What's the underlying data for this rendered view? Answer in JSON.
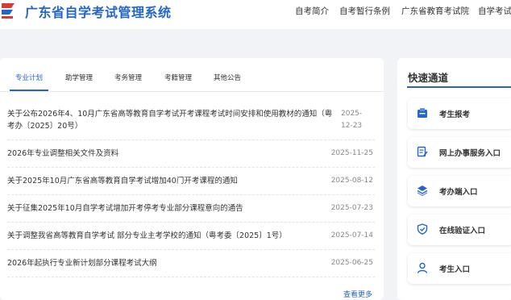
{
  "site": {
    "title": "广东省自学考试管理系统"
  },
  "nav": [
    {
      "label": "自考简介"
    },
    {
      "label": "自考暂行条例"
    },
    {
      "label": "广东省教育考试院"
    },
    {
      "label": "自学考试"
    }
  ],
  "tabs": [
    {
      "label": "专业计划"
    },
    {
      "label": "助学管理"
    },
    {
      "label": "考务管理"
    },
    {
      "label": "考籍管理"
    },
    {
      "label": "其他公告"
    }
  ],
  "news": [
    {
      "title": "关于公布2026年4、10月广东省高等教育自学考试开考课程考试时间安排和使用教材的通知（粤考办〔2025〕20号）",
      "date": "2025-12-23"
    },
    {
      "title": "2026年专业调整相关文件及资料",
      "date": "2025-11-25"
    },
    {
      "title": "关于2025年10月广东省高等教育自学考试增加40门开考课程的通知",
      "date": "2025-08-12"
    },
    {
      "title": "关于征集2025年10月自学考试增加开考停考专业部分课程意向的通告",
      "date": "2025-07-23"
    },
    {
      "title": "关于调整我省高等教育自学考试 部分专业主考学校的通知（粤考委〔2025〕1号）",
      "date": "2025-07-14"
    },
    {
      "title": "2026年起执行专业新计划部分课程考试大纲",
      "date": "2025-06-25"
    }
  ],
  "more_label": "查看更多",
  "quick": {
    "title": "快速通道",
    "items": [
      {
        "label": "考生报考",
        "icon": "registration-icon"
      },
      {
        "label": "网上办事服务入口",
        "icon": "online-service-icon"
      },
      {
        "label": "考办端入口",
        "icon": "layers-icon"
      },
      {
        "label": "在线验证入口",
        "icon": "shield-check-icon"
      },
      {
        "label": "考生入口",
        "icon": "user-icon"
      }
    ]
  },
  "colors": {
    "accent": "#2466c8",
    "background": "#f1f3f6"
  }
}
